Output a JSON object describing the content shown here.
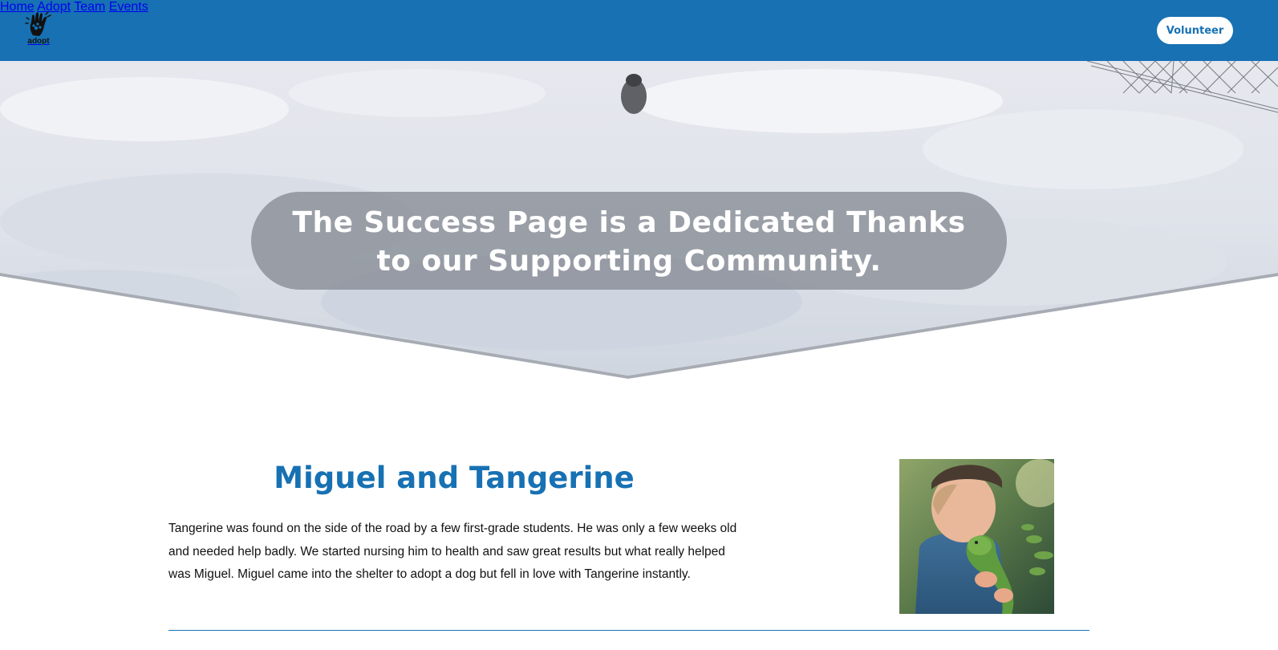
{
  "brand": {
    "logo_text": "adopt"
  },
  "nav": {
    "items": [
      {
        "label": "Home"
      },
      {
        "label": "Adopt"
      },
      {
        "label": "Team"
      },
      {
        "label": "Events"
      }
    ],
    "cta_label": "Volunteer"
  },
  "hero": {
    "title_line1": "The Success Page is a Dedicated Thanks",
    "title_line2": "to our Supporting Community."
  },
  "story": {
    "title": "Miguel and Tangerine",
    "body": "Tangerine was found on the side of the road by a few first-grade students. He was only a few weeks old and needed help badly. We started nursing him to health and saw great results but what really helped was Miguel. Miguel came into the shelter to adopt a dog but fell in love with Tangerine instantly."
  },
  "colors": {
    "brand_blue": "#1771b3",
    "white": "#ffffff",
    "text": "#111111"
  },
  "icons": [
    "hand-paw-logo-icon"
  ]
}
